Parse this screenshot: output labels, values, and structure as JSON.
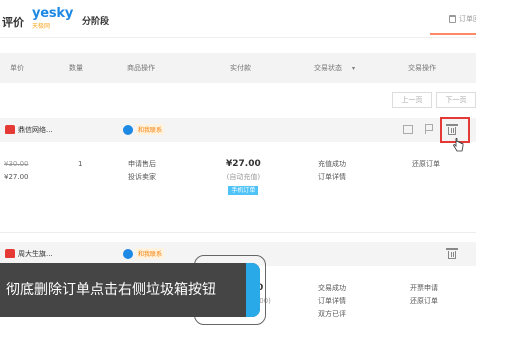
{
  "topbar": {
    "title_prefix": "评价",
    "logo_text": "yesky",
    "logo_sub": "天极网",
    "title_suffix": "分阶段",
    "recycle_link": "订单回收站",
    "colors": {
      "accent": "#ff8a65",
      "logo": "#1e88e5"
    }
  },
  "table_header": {
    "columns": [
      "单价",
      "数量",
      "商品操作",
      "实付款",
      "交易状态",
      "交易操作"
    ],
    "filter_caret": "▾"
  },
  "pager": {
    "prev": "上一页",
    "next": "下一页"
  },
  "orders": [
    {
      "shop_name": "鼎信网络...",
      "contact_label": "和我联系",
      "original_price": "¥30.00",
      "unit_price": "¥27.00",
      "quantity": "1",
      "item_ops": [
        "申请售后",
        "投诉卖家"
      ],
      "paid": "¥27.00",
      "paid_note": "(自动充值)",
      "paid_tag": "手机订单",
      "status": [
        "充值成功",
        "订单详情"
      ],
      "actions": [
        "还原订单"
      ]
    },
    {
      "shop_name": "周大生旗...",
      "contact_label": "和我联系",
      "paid_partial": "0",
      "paid_note_partial": ".00)",
      "status": [
        "交易成功",
        "订单详情",
        "双方已评"
      ],
      "actions": [
        "开票申请",
        "还原订单"
      ]
    }
  ],
  "toast": {
    "text": "彻底删除订单点击右侧垃圾箱按钮",
    "colors": {
      "bg": "#454545",
      "accent": "#29a9e8"
    }
  },
  "highlight": {
    "color": "#e53935"
  }
}
